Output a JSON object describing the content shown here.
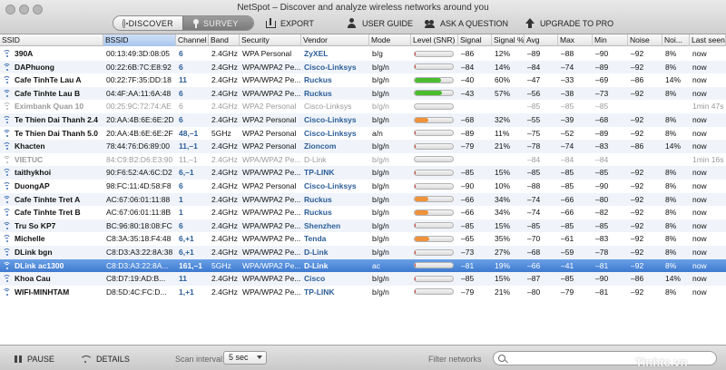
{
  "window": {
    "title": "NetSpot – Discover and analyze wireless networks around you"
  },
  "mode_switch": {
    "discover_label": "DISCOVER",
    "survey_label": "SURVEY",
    "selected": "DISCOVER"
  },
  "toolbar": {
    "export_label": "EXPORT",
    "user_guide_label": "USER GUIDE",
    "ask_label": "ASK A QUESTION",
    "upgrade_label": "UPGRADE TO PRO"
  },
  "table": {
    "columns": [
      "SSID",
      "BSSID",
      "Channel",
      "Band",
      "Security",
      "Vendor",
      "Mode",
      "Level (SNR)",
      "Signal",
      "Signal %",
      "Avg",
      "Max",
      "Min",
      "Noise",
      "Noi...",
      "Last seen"
    ],
    "sorted_column": "BSSID",
    "rows": [
      {
        "ssid": "390A",
        "bssid": "00:13:49:3D:08:05",
        "channel": "6",
        "band": "2.4GHz",
        "security": "WPA Personal",
        "vendor": "ZyXEL",
        "mode": "b/g",
        "snr": 0.03,
        "snr_color": "#d9362c",
        "signal": "–86",
        "signal_pct": "12%",
        "avg": "–89",
        "max": "–88",
        "min": "–90",
        "noise": "–92",
        "noise_pct": "8%",
        "last_seen": "now",
        "active": true
      },
      {
        "ssid": "DAPhuong",
        "bssid": "00:22:6B:7C:E8:92",
        "channel": "6",
        "band": "2.4GHz",
        "security": "WPA/WPA2 Pe...",
        "vendor": "Cisco-Linksys",
        "mode": "b/g/n",
        "snr": 0.03,
        "snr_color": "#d9362c",
        "signal": "–84",
        "signal_pct": "14%",
        "avg": "–84",
        "max": "–74",
        "min": "–89",
        "noise": "–92",
        "noise_pct": "8%",
        "last_seen": "now",
        "active": true
      },
      {
        "ssid": "Cafe TinhTe Lau A",
        "bssid": "00:22:7F:35:DD:18",
        "channel": "11",
        "band": "2.4GHz",
        "security": "WPA/WPA2 Pe...",
        "vendor": "Ruckus",
        "mode": "b/g/n",
        "snr": 0.7,
        "snr_color": "#4cbc2f",
        "signal": "–40",
        "signal_pct": "60%",
        "avg": "–47",
        "max": "–33",
        "min": "–69",
        "noise": "–86",
        "noise_pct": "14%",
        "last_seen": "now",
        "active": true
      },
      {
        "ssid": "Cafe Tinhte Lau B",
        "bssid": "04:4F:AA:11:6A:48",
        "channel": "6",
        "band": "2.4GHz",
        "security": "WPA/WPA2 Pe...",
        "vendor": "Ruckus",
        "mode": "b/g/n",
        "snr": 0.72,
        "snr_color": "#4cbc2f",
        "signal": "–43",
        "signal_pct": "57%",
        "avg": "–56",
        "max": "–38",
        "min": "–73",
        "noise": "–92",
        "noise_pct": "8%",
        "last_seen": "now",
        "active": true
      },
      {
        "ssid": "Eximbank Quan 10",
        "bssid": "00:25:9C:72:74:AE",
        "channel": "6",
        "band": "2.4GHz",
        "security": "WPA2 Personal",
        "vendor": "Cisco-Linksys",
        "mode": "b/g/n",
        "snr": 0,
        "snr_color": "#d9362c",
        "signal": "",
        "signal_pct": "",
        "avg": "–85",
        "max": "–85",
        "min": "–85",
        "noise": "",
        "noise_pct": "",
        "last_seen": "1min 47s",
        "active": false
      },
      {
        "ssid": "Te Thien Dai Thanh 2.4",
        "bssid": "20:AA:4B:6E:6E:2D",
        "channel": "6",
        "band": "2.4GHz",
        "security": "WPA2 Personal",
        "vendor": "Cisco-Linksys",
        "mode": "b/g/n",
        "snr": 0.35,
        "snr_color": "#f0923a",
        "signal": "–68",
        "signal_pct": "32%",
        "avg": "–55",
        "max": "–39",
        "min": "–68",
        "noise": "–92",
        "noise_pct": "8%",
        "last_seen": "now",
        "active": true
      },
      {
        "ssid": "Te Thien Dai Thanh 5.0",
        "bssid": "20:AA:4B:6E:6E:2F",
        "channel": "48,–1",
        "band": "5GHz",
        "security": "WPA2 Personal",
        "vendor": "Cisco-Linksys",
        "mode": "a/n",
        "snr": 0.03,
        "snr_color": "#d9362c",
        "signal": "–89",
        "signal_pct": "11%",
        "avg": "–75",
        "max": "–52",
        "min": "–89",
        "noise": "–92",
        "noise_pct": "8%",
        "last_seen": "now",
        "active": true
      },
      {
        "ssid": "Khacten",
        "bssid": "78:44:76:D6:89:00",
        "channel": "11,–1",
        "band": "2.4GHz",
        "security": "WPA2 Personal",
        "vendor": "Zioncom",
        "mode": "b/g/n",
        "snr": 0.03,
        "snr_color": "#d9362c",
        "signal": "–79",
        "signal_pct": "21%",
        "avg": "–78",
        "max": "–74",
        "min": "–83",
        "noise": "–86",
        "noise_pct": "14%",
        "last_seen": "now",
        "active": true
      },
      {
        "ssid": "VIETUC",
        "bssid": "84:C9:B2:D6:E3:90",
        "channel": "11,–1",
        "band": "2.4GHz",
        "security": "WPA/WPA2 Pe...",
        "vendor": "D-Link",
        "mode": "b/g/n",
        "snr": 0,
        "snr_color": "#d9362c",
        "signal": "",
        "signal_pct": "",
        "avg": "–84",
        "max": "–84",
        "min": "–84",
        "noise": "",
        "noise_pct": "",
        "last_seen": "1min 16s",
        "active": false
      },
      {
        "ssid": "taithykhoi",
        "bssid": "90:F6:52:4A:6C:D2",
        "channel": "6,–1",
        "band": "2.4GHz",
        "security": "WPA/WPA2 Pe...",
        "vendor": "TP-LINK",
        "mode": "b/g/n",
        "snr": 0.03,
        "snr_color": "#d9362c",
        "signal": "–85",
        "signal_pct": "15%",
        "avg": "–85",
        "max": "–85",
        "min": "–85",
        "noise": "–92",
        "noise_pct": "8%",
        "last_seen": "now",
        "active": true
      },
      {
        "ssid": "DuongAP",
        "bssid": "98:FC:11:4D:58:F8",
        "channel": "6",
        "band": "2.4GHz",
        "security": "WPA2 Personal",
        "vendor": "Cisco-Linksys",
        "mode": "b/g/n",
        "snr": 0.03,
        "snr_color": "#d9362c",
        "signal": "–90",
        "signal_pct": "10%",
        "avg": "–88",
        "max": "–85",
        "min": "–90",
        "noise": "–92",
        "noise_pct": "8%",
        "last_seen": "now",
        "active": true
      },
      {
        "ssid": "Cafe Tinhte Tret A",
        "bssid": "AC:67:06:01:11:88",
        "channel": "1",
        "band": "2.4GHz",
        "security": "WPA/WPA2 Pe...",
        "vendor": "Ruckus",
        "mode": "b/g/n",
        "snr": 0.35,
        "snr_color": "#f0923a",
        "signal": "–66",
        "signal_pct": "34%",
        "avg": "–74",
        "max": "–66",
        "min": "–80",
        "noise": "–92",
        "noise_pct": "8%",
        "last_seen": "now",
        "active": true
      },
      {
        "ssid": "Cafe Tinhte Tret B",
        "bssid": "AC:67:06:01:11:8B",
        "channel": "1",
        "band": "2.4GHz",
        "security": "WPA/WPA2 Pe...",
        "vendor": "Ruckus",
        "mode": "b/g/n",
        "snr": 0.35,
        "snr_color": "#f0923a",
        "signal": "–66",
        "signal_pct": "34%",
        "avg": "–74",
        "max": "–66",
        "min": "–82",
        "noise": "–92",
        "noise_pct": "8%",
        "last_seen": "now",
        "active": true
      },
      {
        "ssid": "Tru So KP7",
        "bssid": "BC:96:80:18:08:FC",
        "channel": "6",
        "band": "2.4GHz",
        "security": "WPA/WPA2 Pe...",
        "vendor": "Shenzhen",
        "mode": "b/g/n",
        "snr": 0.03,
        "snr_color": "#d9362c",
        "signal": "–85",
        "signal_pct": "15%",
        "avg": "–85",
        "max": "–85",
        "min": "–85",
        "noise": "–92",
        "noise_pct": "8%",
        "last_seen": "now",
        "active": true
      },
      {
        "ssid": "Michelle",
        "bssid": "C8:3A:35:18:F4:48",
        "channel": "6,+1",
        "band": "2.4GHz",
        "security": "WPA/WPA2 Pe...",
        "vendor": "Tenda",
        "mode": "b/g/n",
        "snr": 0.38,
        "snr_color": "#f0923a",
        "signal": "–65",
        "signal_pct": "35%",
        "avg": "–70",
        "max": "–61",
        "min": "–83",
        "noise": "–92",
        "noise_pct": "8%",
        "last_seen": "now",
        "active": true
      },
      {
        "ssid": "DLink bgn",
        "bssid": "C8:D3:A3:22:8A:38",
        "channel": "6,+1",
        "band": "2.4GHz",
        "security": "WPA/WPA2 Pe...",
        "vendor": "D-Link",
        "mode": "b/g/n",
        "snr": 0.03,
        "snr_color": "#d9362c",
        "signal": "–73",
        "signal_pct": "27%",
        "avg": "–68",
        "max": "–59",
        "min": "–78",
        "noise": "–92",
        "noise_pct": "8%",
        "last_seen": "now",
        "active": true
      },
      {
        "ssid": "DLink ac1300",
        "bssid": "C8:D3:A3:22:8A...",
        "channel": "161,–1",
        "band": "5GHz",
        "security": "WPA/WPA2 Pe...",
        "vendor": "D-Link",
        "mode": "ac",
        "snr": 0.03,
        "snr_color": "#d9362c",
        "signal": "–81",
        "signal_pct": "19%",
        "avg": "–66",
        "max": "–41",
        "min": "–81",
        "noise": "–92",
        "noise_pct": "8%",
        "last_seen": "now",
        "active": true,
        "selected": true
      },
      {
        "ssid": "Khoa Cau",
        "bssid": "C8:D7:19:AD:B...",
        "channel": "11",
        "band": "2.4GHz",
        "security": "WPA/WPA2 Pe...",
        "vendor": "Cisco",
        "mode": "b/g/n",
        "snr": 0.03,
        "snr_color": "#d9362c",
        "signal": "–85",
        "signal_pct": "15%",
        "avg": "–87",
        "max": "–85",
        "min": "–90",
        "noise": "–86",
        "noise_pct": "14%",
        "last_seen": "now",
        "active": true
      },
      {
        "ssid": "WIFI-MINHTAM",
        "bssid": "D8:5D:4C:FC:D...",
        "channel": "1,+1",
        "band": "2.4GHz",
        "security": "WPA/WPA2 Pe...",
        "vendor": "TP-LINK",
        "mode": "b/g/n",
        "snr": 0.03,
        "snr_color": "#d9362c",
        "signal": "–79",
        "signal_pct": "21%",
        "avg": "–80",
        "max": "–79",
        "min": "–81",
        "noise": "–92",
        "noise_pct": "8%",
        "last_seen": "now",
        "active": true
      }
    ]
  },
  "footer": {
    "pause_label": "PAUSE",
    "details_label": "DETAILS",
    "scan_interval_label": "Scan interval:",
    "scan_interval_value": "5 sec",
    "filter_label": "Filter networks",
    "filter_placeholder": "",
    "watermark": "Tinhte.vn"
  },
  "icons": [
    "wifi-icon",
    "discover-icon",
    "survey-pin-icon",
    "export-icon",
    "user-guide-icon",
    "ask-question-icon",
    "upgrade-icon",
    "pause-icon",
    "details-icon",
    "search-icon"
  ]
}
